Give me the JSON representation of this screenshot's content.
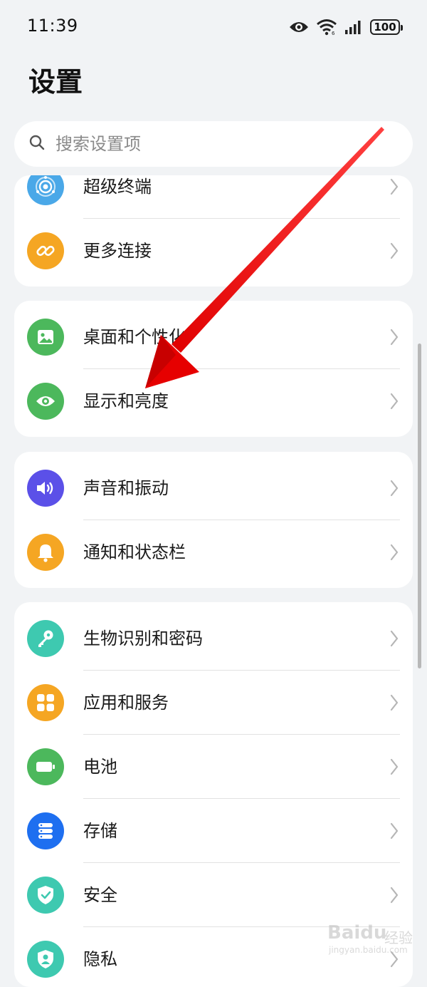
{
  "status_bar": {
    "time": "11:39",
    "battery": "100"
  },
  "page_title": "设置",
  "search": {
    "placeholder": "搜索设置项"
  },
  "groups": [
    {
      "items": [
        {
          "label": "超级终端",
          "icon": "super-device-icon",
          "color": "#4aa8e8"
        },
        {
          "label": "更多连接",
          "icon": "link-icon",
          "color": "#f5a623"
        }
      ]
    },
    {
      "items": [
        {
          "label": "桌面和个性化",
          "icon": "image-icon",
          "color": "#4cb85c"
        },
        {
          "label": "显示和亮度",
          "icon": "eye-icon",
          "color": "#4cb85c"
        }
      ]
    },
    {
      "items": [
        {
          "label": "声音和振动",
          "icon": "volume-icon",
          "color": "#5b50e8"
        },
        {
          "label": "通知和状态栏",
          "icon": "bell-icon",
          "color": "#f5a623"
        }
      ]
    },
    {
      "items": [
        {
          "label": "生物识别和密码",
          "icon": "key-icon",
          "color": "#3ec9b0"
        },
        {
          "label": "应用和服务",
          "icon": "apps-icon",
          "color": "#f5a623"
        },
        {
          "label": "电池",
          "icon": "battery-icon",
          "color": "#4cb85c"
        },
        {
          "label": "存储",
          "icon": "storage-icon",
          "color": "#1e6ff0"
        },
        {
          "label": "安全",
          "icon": "shield-icon",
          "color": "#3ec9b0"
        },
        {
          "label": "隐私",
          "icon": "privacy-icon",
          "color": "#3ec9b0"
        }
      ]
    }
  ],
  "watermark": {
    "brand": "Baidu",
    "cn": "经验",
    "url": "jingyan.baidu.com"
  }
}
